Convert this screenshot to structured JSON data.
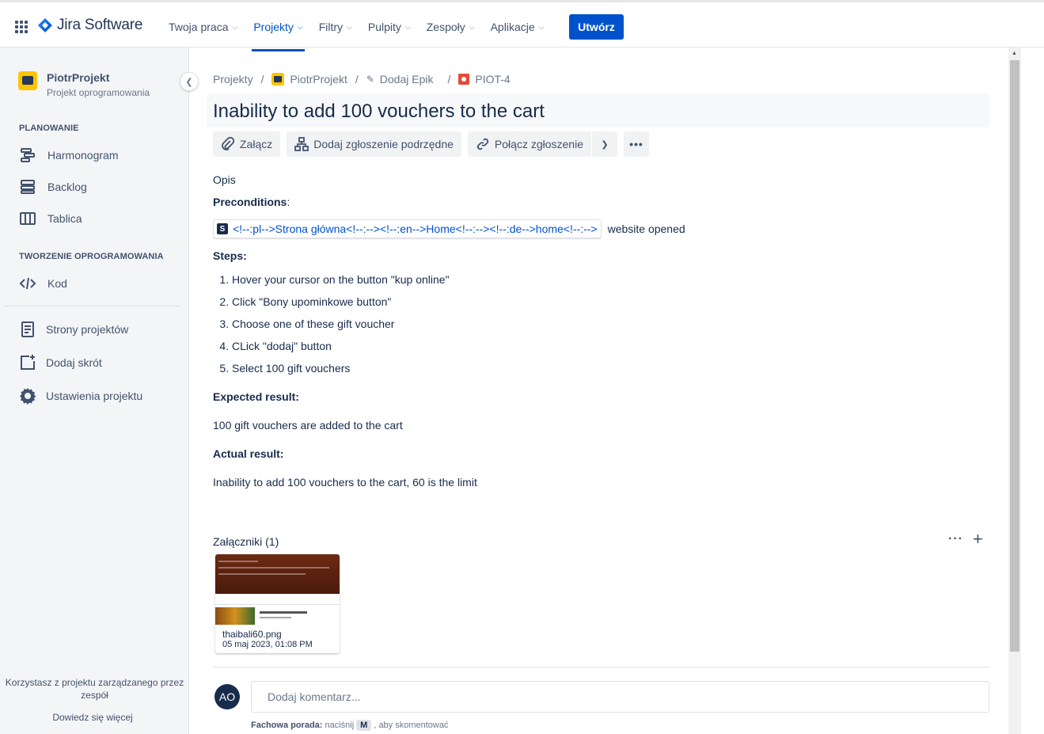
{
  "topnav": {
    "logo": "Jira Software",
    "items": [
      {
        "label": "Twoja praca"
      },
      {
        "label": "Projekty"
      },
      {
        "label": "Filtry"
      },
      {
        "label": "Pulpity"
      },
      {
        "label": "Zespoły"
      },
      {
        "label": "Aplikacje"
      }
    ],
    "create": "Utwórz",
    "accent": "#0052cc"
  },
  "sidebar": {
    "project_name": "PiotrProjekt",
    "project_type": "Projekt oprogramowania",
    "planning_title": "PLANOWANIE",
    "planning_items": [
      "Harmonogram",
      "Backlog",
      "Tablica"
    ],
    "dev_title": "TWORZENIE OPROGRAMOWANIA",
    "dev_items": [
      "Kod"
    ],
    "other_items": [
      "Strony projektów",
      "Dodaj skrót",
      "Ustawienia projektu"
    ],
    "footer_text": "Korzystasz z projektu zarządzanego przez zespół",
    "learn_more": "Dowiedz się więcej"
  },
  "breadcrumbs": [
    "Projekty",
    "PiotrProjekt",
    "Dodaj Epik",
    "PIOT-4"
  ],
  "issue": {
    "title": "Inability to add 100 vouchers to the cart",
    "toolbar": {
      "attach": "Załącz",
      "add_child": "Dodaj zgłoszenie podrzędne",
      "link": "Połącz zgłoszenie"
    },
    "description_label": "Opis",
    "preconditions_label": "Preconditions",
    "preconditions_link": "<!--:pl-->Strona główna<!--:--><!--:en-->Home<!--:--><!--:de-->home<!--:-->",
    "preconditions_suffix": "website opened",
    "steps_label": "Steps:",
    "steps": [
      "Hover your cursor on the button \"kup online\"",
      "Click \"Bony upominkowe button\"",
      "Choose one of these gift voucher",
      "CLick \"dodaj\" button",
      "Select 100 gift vouchers"
    ],
    "expected_label": "Expected result:",
    "expected": "100 gift vouchers are added to the cart",
    "actual_label": "Actual result:",
    "actual": "Inability to add 100 vouchers to the cart, 60 is the limit"
  },
  "attachments": {
    "header": "Załączniki (1)",
    "files": [
      {
        "name": "thaibali60.png",
        "date": "05 maj 2023, 01:08 PM"
      }
    ]
  },
  "comment": {
    "avatar": "AO",
    "placeholder": "Dodaj komentarz...",
    "tip_bold": "Fachowa porada:",
    "tip_pre": "naciśnij",
    "tip_key": "M",
    "tip_post": ", aby skomentować"
  }
}
